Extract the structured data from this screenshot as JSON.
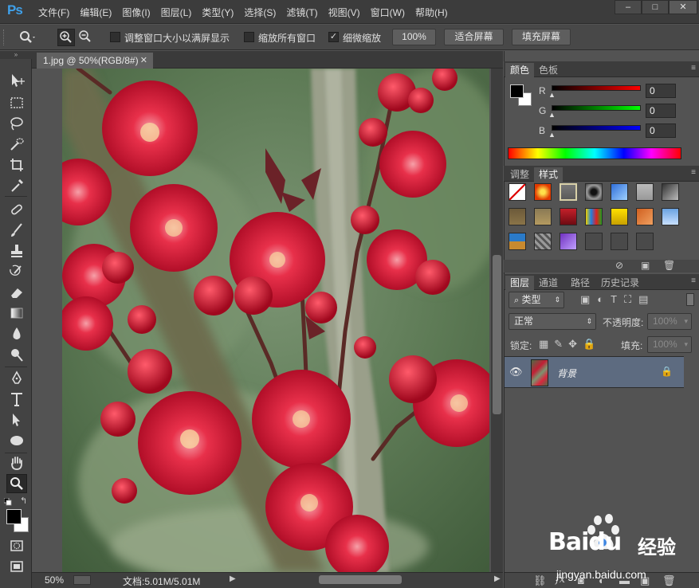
{
  "app": {
    "logo": "Ps"
  },
  "menu": [
    "文件(F)",
    "编辑(E)",
    "图像(I)",
    "图层(L)",
    "类型(Y)",
    "选择(S)",
    "滤镜(T)",
    "视图(V)",
    "窗口(W)",
    "帮助(H)"
  ],
  "window_controls": {
    "minimize": "–",
    "restore": "□",
    "close": "✕"
  },
  "options": {
    "resize_windows_label": "调整窗口大小以满屏显示",
    "resize_windows_checked": false,
    "zoom_all_label": "缩放所有窗口",
    "zoom_all_checked": false,
    "scrubby_zoom_label": "细微缩放",
    "scrubby_zoom_checked": true,
    "actual_pixels_button": "100%",
    "fit_screen_button": "适合屏幕",
    "fill_screen_button": "填充屏幕"
  },
  "document": {
    "tab_label": "1.jpg @ 50%(RGB/8#)",
    "zoom": "50%",
    "doc_size": "文档:5.01M/5.01M"
  },
  "color_panel": {
    "tabs": [
      "颜色",
      "色板"
    ],
    "r_label": "R",
    "g_label": "G",
    "b_label": "B",
    "r_value": "0",
    "g_value": "0",
    "b_value": "0"
  },
  "styles_panel": {
    "tabs": [
      "调整",
      "样式"
    ]
  },
  "layers_panel": {
    "tabs": [
      "图层",
      "通道",
      "路径",
      "历史记录"
    ],
    "filter_label": "类型",
    "blend_mode": "正常",
    "opacity_label": "不透明度:",
    "opacity_value": "100%",
    "lock_label": "锁定:",
    "fill_label": "填充:",
    "fill_value": "100%",
    "layers": [
      {
        "name": "背景",
        "visible": true,
        "locked": true
      }
    ]
  },
  "watermark": {
    "brand": "Baidu",
    "brand_cn": "经验",
    "url": "jingyan.baidu.com"
  },
  "colors": {
    "accent_blue": "#3fa0e9",
    "selected_layer": "#5d6b80",
    "foreground": "#000000",
    "background": "#ffffff"
  }
}
